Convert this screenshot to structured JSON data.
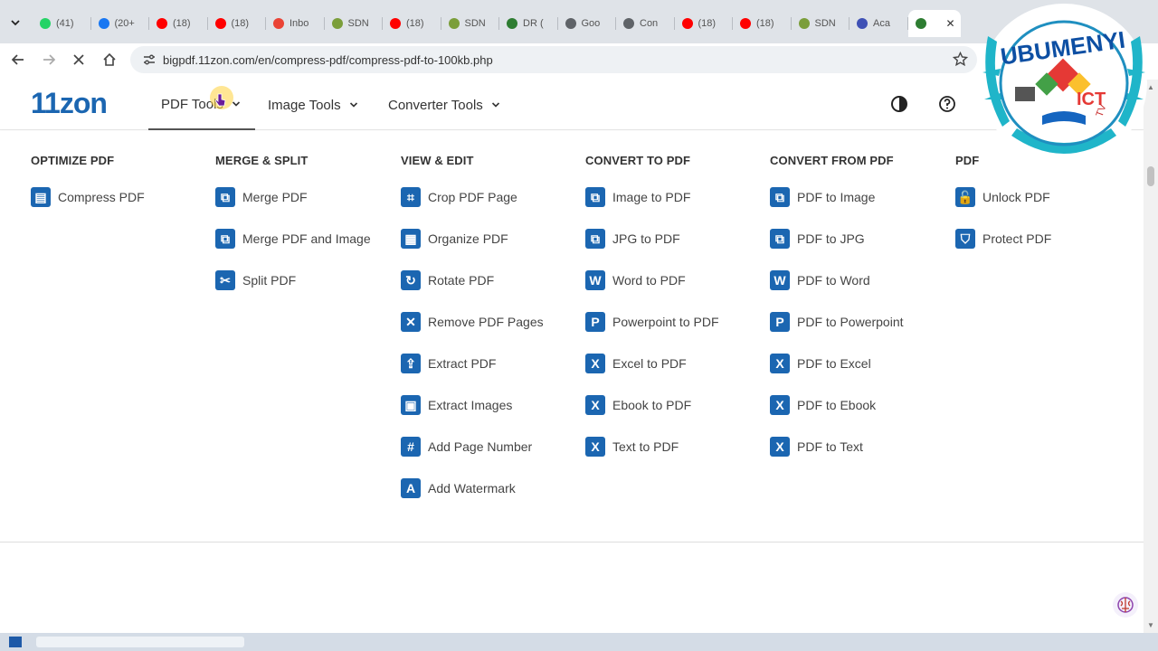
{
  "browser": {
    "tabs": [
      {
        "label": "(41)",
        "icon": "whatsapp-icon",
        "color": "#25d366"
      },
      {
        "label": "(20+",
        "icon": "facebook-icon",
        "color": "#1877f2"
      },
      {
        "label": "(18)",
        "icon": "youtube-icon",
        "color": "#ff0000"
      },
      {
        "label": "(18)",
        "icon": "youtube-icon",
        "color": "#ff0000"
      },
      {
        "label": "Inbo",
        "icon": "gmail-icon",
        "color": "#ea4335"
      },
      {
        "label": "SDN",
        "icon": "sdms-icon",
        "color": "#7b9e3a"
      },
      {
        "label": "(18)",
        "icon": "youtube-icon",
        "color": "#ff0000"
      },
      {
        "label": "SDN",
        "icon": "sdms-icon",
        "color": "#7b9e3a"
      },
      {
        "label": "DR (",
        "icon": "drive-icon",
        "color": "#2e7d32"
      },
      {
        "label": "Goo",
        "icon": "globe-icon",
        "color": "#5f6368"
      },
      {
        "label": "Con",
        "icon": "globe-icon",
        "color": "#5f6368"
      },
      {
        "label": "(18)",
        "icon": "youtube-icon",
        "color": "#ff0000"
      },
      {
        "label": "(18)",
        "icon": "youtube-icon",
        "color": "#ff0000"
      },
      {
        "label": "SDN",
        "icon": "sdms-icon",
        "color": "#7b9e3a"
      },
      {
        "label": "Aca",
        "icon": "academy-icon",
        "color": "#3f51b5"
      }
    ],
    "active_tab_close": "✕",
    "url": "bigpdf.11zon.com/en/compress-pdf/compress-pdf-to-100kb.php"
  },
  "site": {
    "logo": "11zon",
    "menu": {
      "pdf_tools": "PDF Tools",
      "image_tools": "Image Tools",
      "converter_tools": "Converter Tools"
    }
  },
  "mega": {
    "columns": [
      {
        "title": "OPTIMIZE PDF",
        "items": [
          {
            "label": "Compress PDF",
            "glyph": "▤"
          }
        ]
      },
      {
        "title": "MERGE & SPLIT",
        "items": [
          {
            "label": "Merge PDF",
            "glyph": "⧉"
          },
          {
            "label": "Merge PDF and Image",
            "glyph": "⧉"
          },
          {
            "label": "Split PDF",
            "glyph": "✂"
          }
        ]
      },
      {
        "title": "VIEW & EDIT",
        "items": [
          {
            "label": "Crop PDF Page",
            "glyph": "⌗"
          },
          {
            "label": "Organize PDF",
            "glyph": "▦"
          },
          {
            "label": "Rotate PDF",
            "glyph": "↻"
          },
          {
            "label": "Remove PDF Pages",
            "glyph": "✕"
          },
          {
            "label": "Extract PDF",
            "glyph": "⇪"
          },
          {
            "label": "Extract Images",
            "glyph": "▣"
          },
          {
            "label": "Add Page Number",
            "glyph": "#"
          },
          {
            "label": "Add Watermark",
            "glyph": "A"
          }
        ]
      },
      {
        "title": "CONVERT TO PDF",
        "items": [
          {
            "label": "Image to PDF",
            "glyph": "⧉"
          },
          {
            "label": "JPG to PDF",
            "glyph": "⧉"
          },
          {
            "label": "Word to PDF",
            "glyph": "W"
          },
          {
            "label": "Powerpoint to PDF",
            "glyph": "P"
          },
          {
            "label": "Excel to PDF",
            "glyph": "X"
          },
          {
            "label": "Ebook to PDF",
            "glyph": "X"
          },
          {
            "label": "Text to PDF",
            "glyph": "X"
          }
        ]
      },
      {
        "title": "CONVERT FROM PDF",
        "items": [
          {
            "label": "PDF to Image",
            "glyph": "⧉"
          },
          {
            "label": "PDF to JPG",
            "glyph": "⧉"
          },
          {
            "label": "PDF to Word",
            "glyph": "W"
          },
          {
            "label": "PDF to Powerpoint",
            "glyph": "P"
          },
          {
            "label": "PDF to Excel",
            "glyph": "X"
          },
          {
            "label": "PDF to Ebook",
            "glyph": "X"
          },
          {
            "label": "PDF to Text",
            "glyph": "X"
          }
        ]
      },
      {
        "title": "PDF",
        "items": [
          {
            "label": "Unlock PDF",
            "glyph": "🔓"
          },
          {
            "label": "Protect PDF",
            "glyph": "⛉"
          }
        ]
      }
    ]
  },
  "overlay": {
    "text": "UBUMENYI",
    "sub": "ICT",
    "tv": "TV"
  },
  "colors": {
    "brand": "#1b66b1",
    "tabstrip": "#dfe3e8",
    "overlay_ring": "#1fb5c9"
  }
}
